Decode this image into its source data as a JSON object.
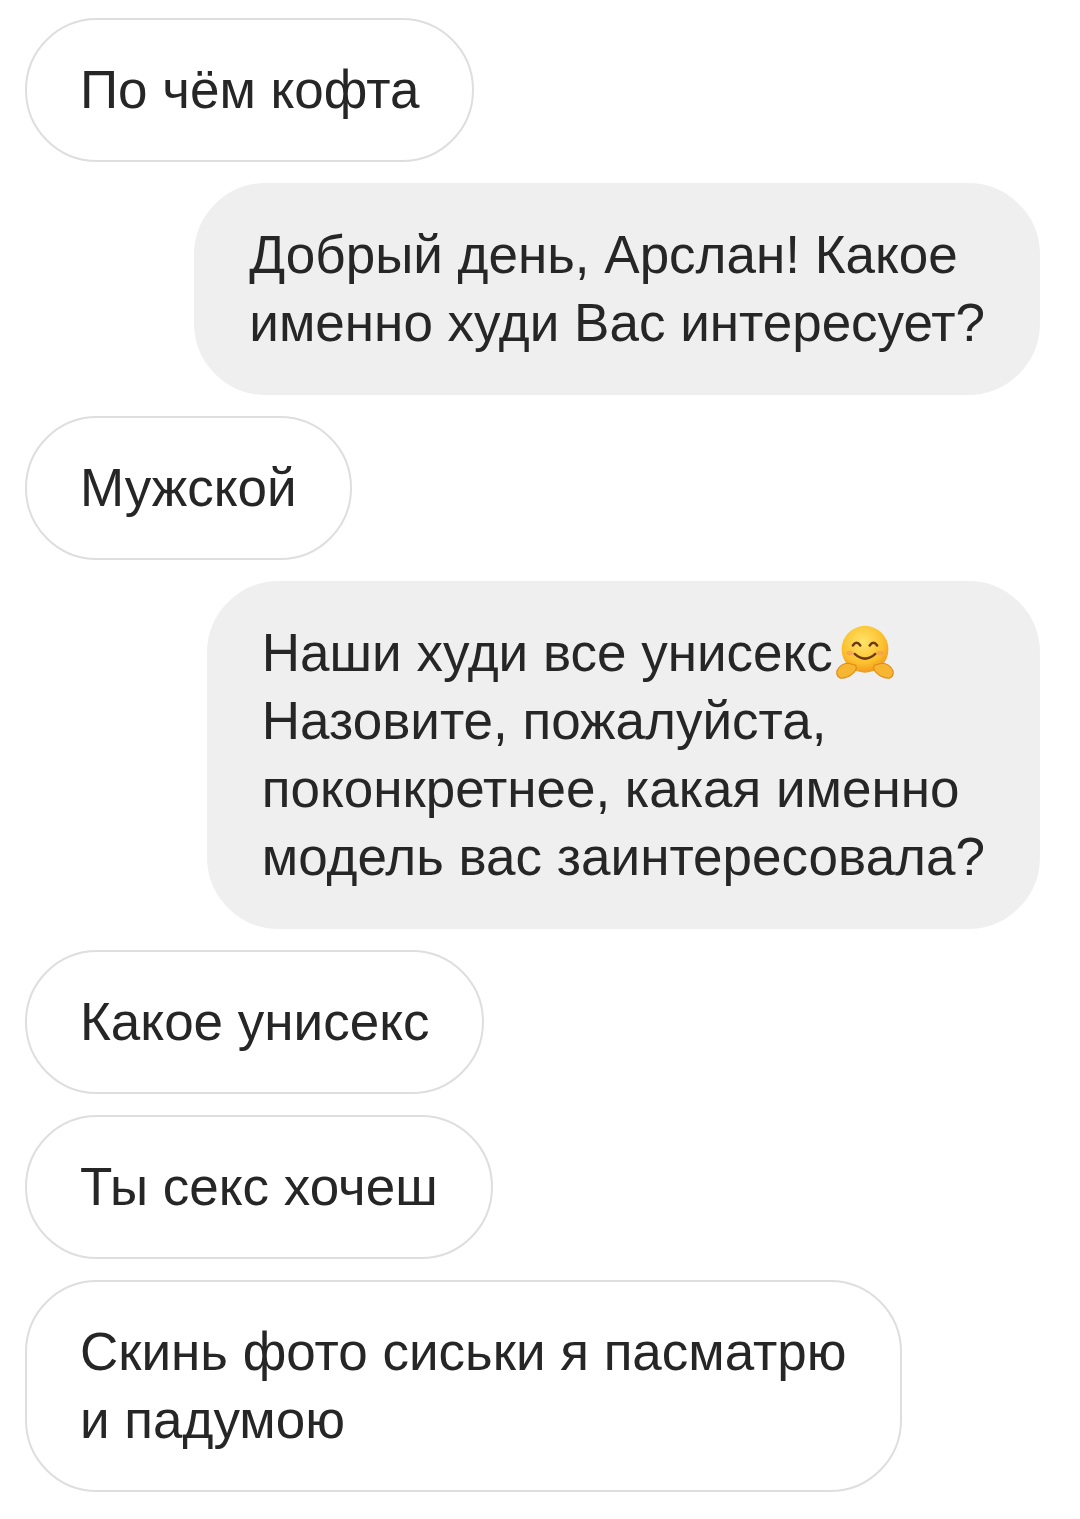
{
  "messages": [
    {
      "outgoing": false,
      "paragraphs": [
        {
          "text": "По чём кофта"
        }
      ]
    },
    {
      "outgoing": true,
      "paragraphs": [
        {
          "text": "Добрый день, Арслан! Какое\nименно худи Вас интересует?"
        }
      ]
    },
    {
      "outgoing": false,
      "paragraphs": [
        {
          "text": "Мужской"
        }
      ]
    },
    {
      "outgoing": true,
      "paragraphs": [
        {
          "text": "Наши худи все унисекс",
          "emoji": true
        },
        {
          "text": "Назовите, пожалуйста,\nпоконкретнее, какая именно\nмодель вас заинтересовала?"
        }
      ]
    },
    {
      "outgoing": false,
      "paragraphs": [
        {
          "text": "Какое унисекс"
        }
      ]
    },
    {
      "outgoing": false,
      "paragraphs": [
        {
          "text": "Ты секс хочеш"
        }
      ]
    },
    {
      "outgoing": false,
      "paragraphs": [
        {
          "text": "Скинь фото сиськи я пасматрю\nи падумою"
        }
      ]
    }
  ]
}
